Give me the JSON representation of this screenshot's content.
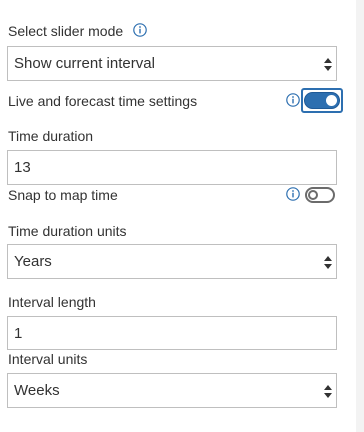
{
  "slider_mode": {
    "label": "Select slider mode",
    "value": "Show current interval"
  },
  "live_forecast": {
    "label": "Live and forecast time settings",
    "enabled": true
  },
  "time_duration": {
    "label": "Time duration",
    "value": "13"
  },
  "snap_to_map_time": {
    "label": "Snap to map time",
    "enabled": false
  },
  "time_duration_units": {
    "label": "Time duration units",
    "value": "Years"
  },
  "interval_length": {
    "label": "Interval length",
    "value": "1"
  },
  "interval_units": {
    "label": "Interval units",
    "value": "Weeks"
  },
  "colors": {
    "accent": "#2d6fb0",
    "text": "#323232",
    "border": "#bfbfbf"
  },
  "icons": [
    "info-icon",
    "select-arrows-icon",
    "toggle-switch"
  ]
}
